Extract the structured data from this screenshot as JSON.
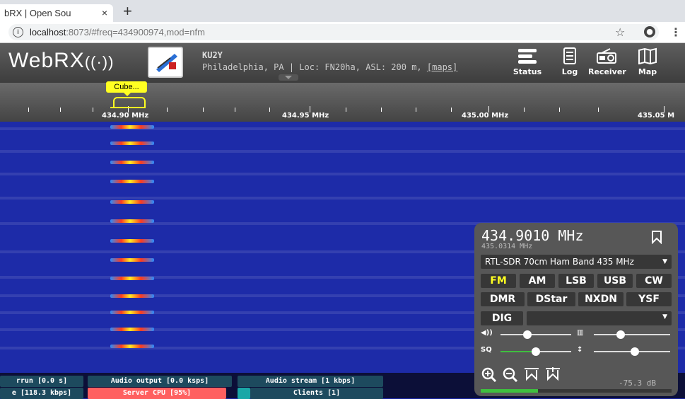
{
  "browser": {
    "tab_title": "bRX | Open Sou",
    "tab_close": "×",
    "new_tab": "+",
    "url_host": "localhost",
    "url_rest": ":8073/#freq=434900974,mod=nfm",
    "info_icon": "i",
    "star_icon": "☆",
    "account_icon": "account-icon",
    "menu_icon": "⋮"
  },
  "header": {
    "logo_text": "WebRX",
    "logo_waves": "((·))",
    "receiver_name": "KU2Y",
    "receiver_location": "Philadelphia, PA | Loc: FN20ha, ASL: 200 m,",
    "maps_link": "[maps]",
    "buttons": [
      {
        "label": "Status",
        "icon": "status-icon"
      },
      {
        "label": "Log",
        "icon": "log-icon"
      },
      {
        "label": "Receiver",
        "icon": "receiver-icon"
      },
      {
        "label": "Map",
        "icon": "map-icon"
      }
    ]
  },
  "scale": {
    "bookmark_label": "Cube...",
    "labels": [
      "434.90 MHz",
      "434.95 MHz",
      "435.00 MHz",
      "435.05 M"
    ]
  },
  "status": {
    "overrun": "rrun [0.0 s]",
    "audio_output": "Audio output [0.0 ksps]",
    "audio_stream": "Audio stream [1 kbps]",
    "network": "e [118.3 kbps]",
    "server_cpu": "Server CPU [95%]",
    "clients": "Clients [1]"
  },
  "panel": {
    "frequency": "434.9010 MHz",
    "center_frequency": "435.0314 MHz",
    "profile": "RTL-SDR 70cm Ham Band 435 MHz",
    "profile_caret": "▼",
    "modes_row1": [
      "FM",
      "AM",
      "LSB",
      "USB",
      "CW"
    ],
    "modes_row2": [
      "DMR",
      "DStar",
      "NXDN",
      "YSF"
    ],
    "dig_label": "DIG",
    "dig_caret": "▼",
    "volume_icon": "🔊",
    "squelch_label": "SQ",
    "squelch_db": "-75.3 dB",
    "smeter_level": 0.3,
    "zoom": [
      "zoom-in-icon",
      "zoom-out-icon",
      "zoom-to-band-icon",
      "zoom-reset-icon"
    ],
    "active_mode": "FM",
    "accent_color": "#ffff22"
  }
}
